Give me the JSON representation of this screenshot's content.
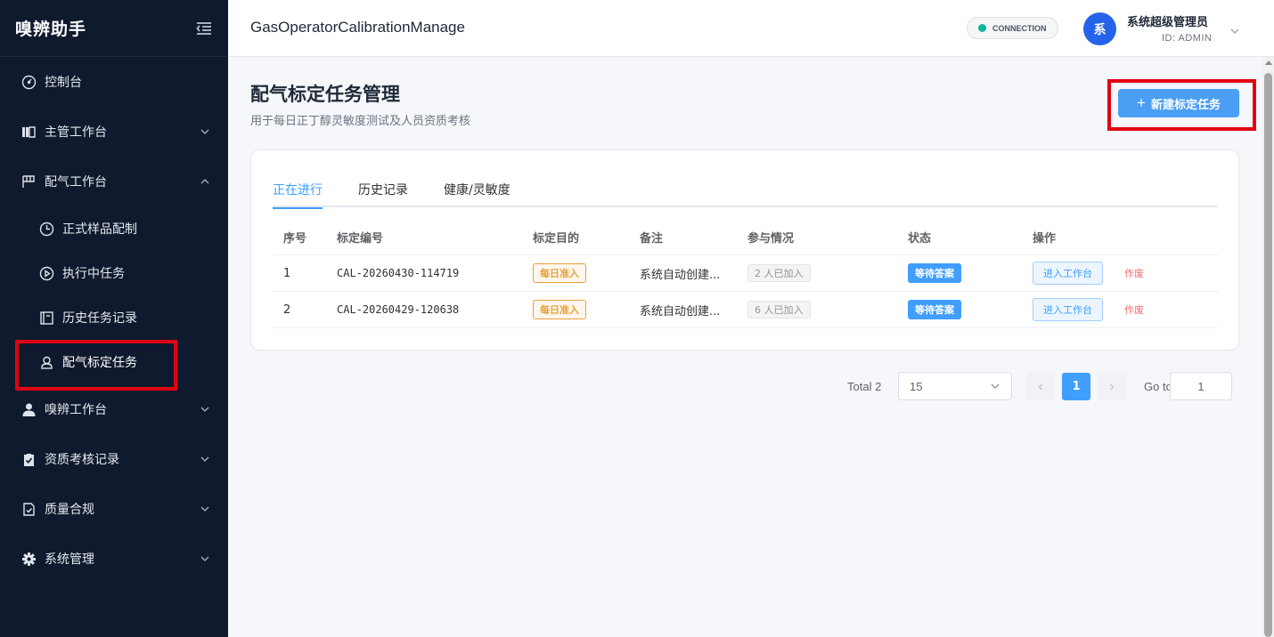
{
  "sidebar": {
    "brand": "嗅辨助手",
    "items": [
      {
        "label": "控制台",
        "icon": "dashboard-icon"
      },
      {
        "label": "主管工作台",
        "icon": "supervisor-icon"
      },
      {
        "label": "配气工作台",
        "icon": "flag-icon",
        "expanded": true
      },
      {
        "label": "正式样品配制",
        "icon": "clock-icon"
      },
      {
        "label": "执行中任务",
        "icon": "play-circle-icon"
      },
      {
        "label": "历史任务记录",
        "icon": "notebook-icon"
      },
      {
        "label": "配气标定任务",
        "icon": "user-icon",
        "active": true
      },
      {
        "label": "嗅辨工作台",
        "icon": "person-icon"
      },
      {
        "label": "资质考核记录",
        "icon": "clipboard-check-icon"
      },
      {
        "label": "质量合规",
        "icon": "document-check-icon"
      },
      {
        "label": "系统管理",
        "icon": "gear-icon"
      }
    ]
  },
  "header": {
    "title": "GasOperatorCalibrationManage",
    "connection": "CONNECTION",
    "avatar_text": "系",
    "user_name": "系统超级管理员",
    "user_id": "ID: ADMIN"
  },
  "main": {
    "title": "配气标定任务管理",
    "subtitle": "用于每日正丁醇灵敏度测试及人员资质考核",
    "new_button": "新建标定任务",
    "tabs": [
      "正在进行",
      "历史记录",
      "健康/灵敏度"
    ],
    "active_tab": 0,
    "columns": [
      "序号",
      "标定编号",
      "标定目的",
      "备注",
      "参与情况",
      "状态",
      "操作"
    ],
    "rows": [
      {
        "seq": "1",
        "code": "CAL-20260430-114719",
        "purpose": "每日准入",
        "note": "系统自动创建...",
        "joined": "2 人已加入",
        "status": "等待答案",
        "enter": "进入工作台",
        "void": "作废"
      },
      {
        "seq": "2",
        "code": "CAL-20260429-120638",
        "purpose": "每日准入",
        "note": "系统自动创建...",
        "joined": "6 人已加入",
        "status": "等待答案",
        "enter": "进入工作台",
        "void": "作废"
      }
    ]
  },
  "pagination": {
    "total": "Total 2",
    "page_size": "15",
    "current_page": "1",
    "goto_label": "Go to",
    "goto_value": "1"
  },
  "colors": {
    "sidebar_bg": "#0f1a2e",
    "primary": "#409eff",
    "highlight": "#e00012"
  }
}
